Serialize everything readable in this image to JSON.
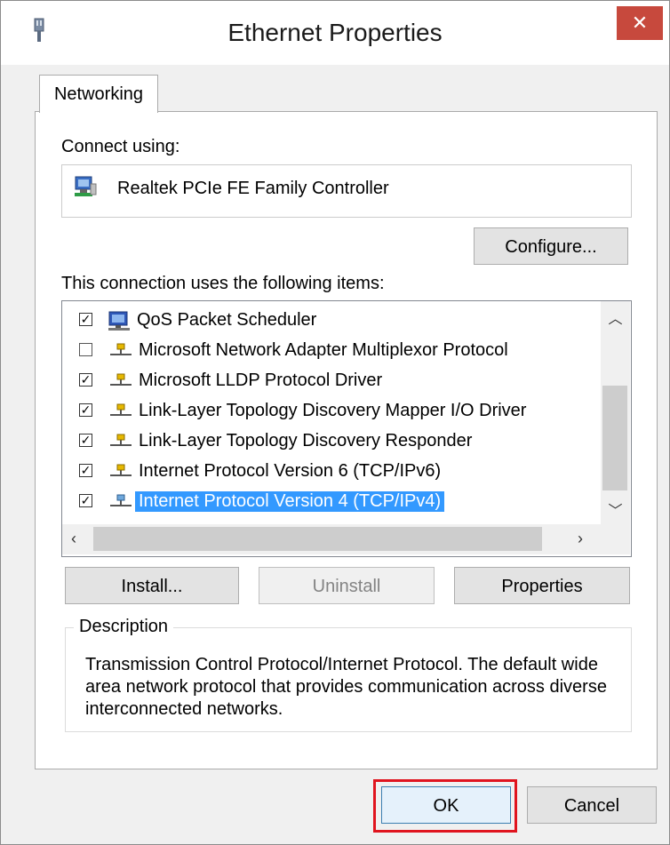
{
  "window": {
    "title": "Ethernet Properties",
    "close_label": "✕"
  },
  "tabs": [
    {
      "label": "Networking",
      "selected": true
    }
  ],
  "connect_using": {
    "label": "Connect using:",
    "adapter_name": "Realtek PCIe FE Family Controller",
    "adapter_icon": "network-adapter-icon"
  },
  "configure_button": "Configure...",
  "items_label": "This connection uses the following items:",
  "items": [
    {
      "label": "QoS Packet Scheduler",
      "checked": true,
      "icon": "scheduler-icon"
    },
    {
      "label": "Microsoft Network Adapter Multiplexor Protocol",
      "checked": false,
      "icon": "protocol-icon"
    },
    {
      "label": "Microsoft LLDP Protocol Driver",
      "checked": true,
      "icon": "protocol-icon"
    },
    {
      "label": "Link-Layer Topology Discovery Mapper I/O Driver",
      "checked": true,
      "icon": "protocol-icon"
    },
    {
      "label": "Link-Layer Topology Discovery Responder",
      "checked": true,
      "icon": "protocol-icon"
    },
    {
      "label": "Internet Protocol Version 6 (TCP/IPv6)",
      "checked": true,
      "icon": "protocol-icon"
    },
    {
      "label": "Internet Protocol Version 4 (TCP/IPv4)",
      "checked": true,
      "icon": "protocol-icon",
      "selected": true
    }
  ],
  "buttons": {
    "install": "Install...",
    "uninstall": "Uninstall",
    "properties": "Properties",
    "ok": "OK",
    "cancel": "Cancel"
  },
  "description": {
    "title": "Description",
    "text": "Transmission Control Protocol/Internet Protocol. The default wide area network protocol that provides communication across diverse interconnected networks."
  },
  "colors": {
    "close_button": "#c7493d",
    "selection": "#3399ff",
    "highlight_box": "#e0141e"
  }
}
